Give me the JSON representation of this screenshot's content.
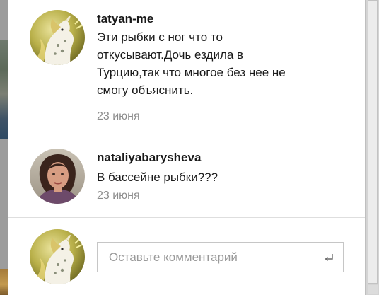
{
  "comments": [
    {
      "author": "tatyan-me",
      "text": "Эти рыбки с ног что то откусывают.Дочь ездила в Турцию,так что многое без нее не смогу объяснить.",
      "date": "23 июня"
    },
    {
      "author": "nataliyabarysheva",
      "text": "В бассейне рыбки???",
      "date": "23 июня"
    }
  ],
  "composer": {
    "placeholder": "Оставьте комментарий",
    "value": ""
  },
  "icons": {
    "submit": "enter-return-icon"
  },
  "colors": {
    "date_gray": "#8c8c8c",
    "panel_bg": "#ffffff",
    "overlay": "#8a8a8a"
  }
}
